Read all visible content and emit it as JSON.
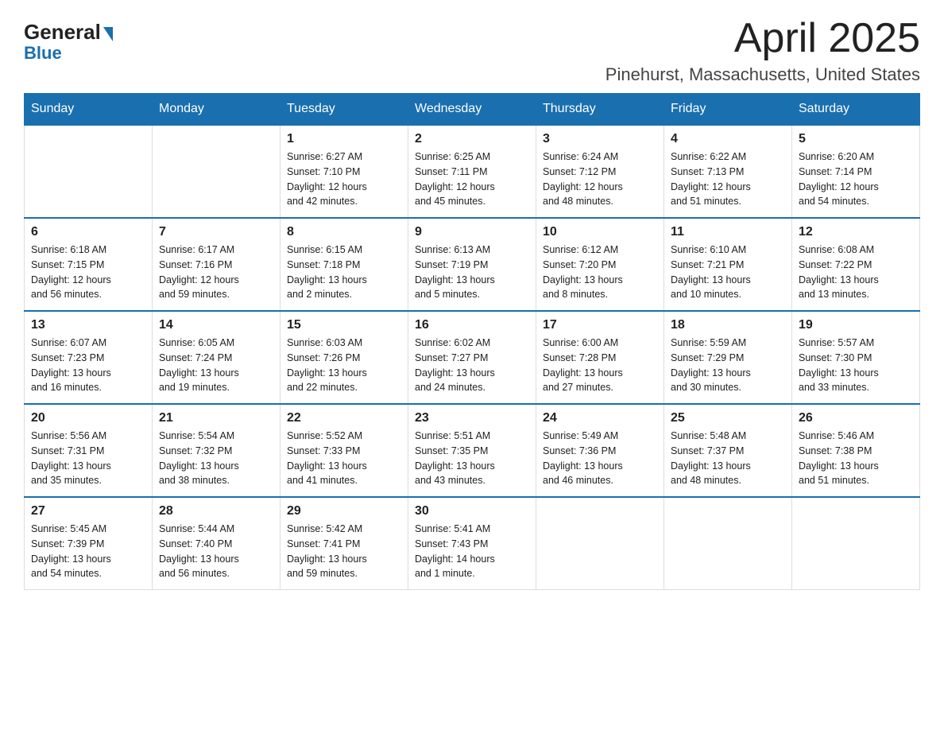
{
  "logo": {
    "general": "General",
    "blue": "Blue"
  },
  "title": "April 2025",
  "subtitle": "Pinehurst, Massachusetts, United States",
  "days_of_week": [
    "Sunday",
    "Monday",
    "Tuesday",
    "Wednesday",
    "Thursday",
    "Friday",
    "Saturday"
  ],
  "weeks": [
    [
      {
        "day": "",
        "info": ""
      },
      {
        "day": "",
        "info": ""
      },
      {
        "day": "1",
        "info": "Sunrise: 6:27 AM\nSunset: 7:10 PM\nDaylight: 12 hours\nand 42 minutes."
      },
      {
        "day": "2",
        "info": "Sunrise: 6:25 AM\nSunset: 7:11 PM\nDaylight: 12 hours\nand 45 minutes."
      },
      {
        "day": "3",
        "info": "Sunrise: 6:24 AM\nSunset: 7:12 PM\nDaylight: 12 hours\nand 48 minutes."
      },
      {
        "day": "4",
        "info": "Sunrise: 6:22 AM\nSunset: 7:13 PM\nDaylight: 12 hours\nand 51 minutes."
      },
      {
        "day": "5",
        "info": "Sunrise: 6:20 AM\nSunset: 7:14 PM\nDaylight: 12 hours\nand 54 minutes."
      }
    ],
    [
      {
        "day": "6",
        "info": "Sunrise: 6:18 AM\nSunset: 7:15 PM\nDaylight: 12 hours\nand 56 minutes."
      },
      {
        "day": "7",
        "info": "Sunrise: 6:17 AM\nSunset: 7:16 PM\nDaylight: 12 hours\nand 59 minutes."
      },
      {
        "day": "8",
        "info": "Sunrise: 6:15 AM\nSunset: 7:18 PM\nDaylight: 13 hours\nand 2 minutes."
      },
      {
        "day": "9",
        "info": "Sunrise: 6:13 AM\nSunset: 7:19 PM\nDaylight: 13 hours\nand 5 minutes."
      },
      {
        "day": "10",
        "info": "Sunrise: 6:12 AM\nSunset: 7:20 PM\nDaylight: 13 hours\nand 8 minutes."
      },
      {
        "day": "11",
        "info": "Sunrise: 6:10 AM\nSunset: 7:21 PM\nDaylight: 13 hours\nand 10 minutes."
      },
      {
        "day": "12",
        "info": "Sunrise: 6:08 AM\nSunset: 7:22 PM\nDaylight: 13 hours\nand 13 minutes."
      }
    ],
    [
      {
        "day": "13",
        "info": "Sunrise: 6:07 AM\nSunset: 7:23 PM\nDaylight: 13 hours\nand 16 minutes."
      },
      {
        "day": "14",
        "info": "Sunrise: 6:05 AM\nSunset: 7:24 PM\nDaylight: 13 hours\nand 19 minutes."
      },
      {
        "day": "15",
        "info": "Sunrise: 6:03 AM\nSunset: 7:26 PM\nDaylight: 13 hours\nand 22 minutes."
      },
      {
        "day": "16",
        "info": "Sunrise: 6:02 AM\nSunset: 7:27 PM\nDaylight: 13 hours\nand 24 minutes."
      },
      {
        "day": "17",
        "info": "Sunrise: 6:00 AM\nSunset: 7:28 PM\nDaylight: 13 hours\nand 27 minutes."
      },
      {
        "day": "18",
        "info": "Sunrise: 5:59 AM\nSunset: 7:29 PM\nDaylight: 13 hours\nand 30 minutes."
      },
      {
        "day": "19",
        "info": "Sunrise: 5:57 AM\nSunset: 7:30 PM\nDaylight: 13 hours\nand 33 minutes."
      }
    ],
    [
      {
        "day": "20",
        "info": "Sunrise: 5:56 AM\nSunset: 7:31 PM\nDaylight: 13 hours\nand 35 minutes."
      },
      {
        "day": "21",
        "info": "Sunrise: 5:54 AM\nSunset: 7:32 PM\nDaylight: 13 hours\nand 38 minutes."
      },
      {
        "day": "22",
        "info": "Sunrise: 5:52 AM\nSunset: 7:33 PM\nDaylight: 13 hours\nand 41 minutes."
      },
      {
        "day": "23",
        "info": "Sunrise: 5:51 AM\nSunset: 7:35 PM\nDaylight: 13 hours\nand 43 minutes."
      },
      {
        "day": "24",
        "info": "Sunrise: 5:49 AM\nSunset: 7:36 PM\nDaylight: 13 hours\nand 46 minutes."
      },
      {
        "day": "25",
        "info": "Sunrise: 5:48 AM\nSunset: 7:37 PM\nDaylight: 13 hours\nand 48 minutes."
      },
      {
        "day": "26",
        "info": "Sunrise: 5:46 AM\nSunset: 7:38 PM\nDaylight: 13 hours\nand 51 minutes."
      }
    ],
    [
      {
        "day": "27",
        "info": "Sunrise: 5:45 AM\nSunset: 7:39 PM\nDaylight: 13 hours\nand 54 minutes."
      },
      {
        "day": "28",
        "info": "Sunrise: 5:44 AM\nSunset: 7:40 PM\nDaylight: 13 hours\nand 56 minutes."
      },
      {
        "day": "29",
        "info": "Sunrise: 5:42 AM\nSunset: 7:41 PM\nDaylight: 13 hours\nand 59 minutes."
      },
      {
        "day": "30",
        "info": "Sunrise: 5:41 AM\nSunset: 7:43 PM\nDaylight: 14 hours\nand 1 minute."
      },
      {
        "day": "",
        "info": ""
      },
      {
        "day": "",
        "info": ""
      },
      {
        "day": "",
        "info": ""
      }
    ]
  ]
}
